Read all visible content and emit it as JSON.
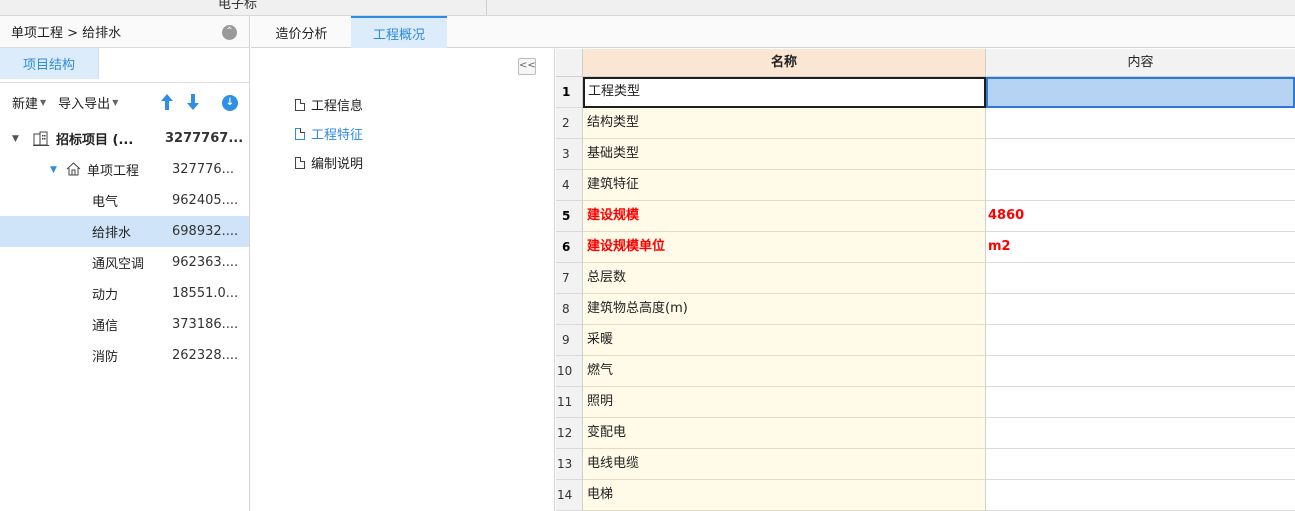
{
  "top": {
    "cut_text": "电子标"
  },
  "left": {
    "breadcrumb": "单项工程 > 给排水",
    "tab": "项目结构",
    "toolbar": {
      "new": "新建",
      "import_export": "导入导出"
    },
    "tree": [
      {
        "name": "招标项目 (...",
        "value": "3277767...",
        "level": 0,
        "bold": true
      },
      {
        "name": "单项工程",
        "value": "327776...",
        "level": 1
      },
      {
        "name": "电气",
        "value": "962405....",
        "level": 2
      },
      {
        "name": "给排水",
        "value": "698932....",
        "level": 2,
        "selected": true
      },
      {
        "name": "通风空调",
        "value": "962363....",
        "level": 2
      },
      {
        "name": "动力",
        "value": "18551.0...",
        "level": 2
      },
      {
        "name": "通信",
        "value": "373186....",
        "level": 2
      },
      {
        "name": "消防",
        "value": "262328....",
        "level": 2
      }
    ]
  },
  "tabs": {
    "cost_analysis": "造价分析",
    "overview": "工程概况"
  },
  "nav": {
    "collapse": "<<",
    "items": [
      "工程信息",
      "工程特征",
      "编制说明"
    ]
  },
  "grid": {
    "headers": {
      "name": "名称",
      "content": "内容"
    },
    "rows": [
      {
        "no": "1",
        "name": "工程类型",
        "value": ""
      },
      {
        "no": "2",
        "name": "结构类型",
        "value": ""
      },
      {
        "no": "3",
        "name": "基础类型",
        "value": ""
      },
      {
        "no": "4",
        "name": "建筑特征",
        "value": ""
      },
      {
        "no": "5",
        "name": "建设规模",
        "value": "4860"
      },
      {
        "no": "6",
        "name": "建设规模单位",
        "value": "m2"
      },
      {
        "no": "7",
        "name": "总层数",
        "value": ""
      },
      {
        "no": "8",
        "name": "建筑物总高度(m)",
        "value": ""
      },
      {
        "no": "9",
        "name": "采暖",
        "value": ""
      },
      {
        "no": "10",
        "name": "燃气",
        "value": ""
      },
      {
        "no": "11",
        "name": "照明",
        "value": ""
      },
      {
        "no": "12",
        "name": "变配电",
        "value": ""
      },
      {
        "no": "13",
        "name": "电线电缆",
        "value": ""
      },
      {
        "no": "14",
        "name": "电梯",
        "value": ""
      }
    ]
  }
}
